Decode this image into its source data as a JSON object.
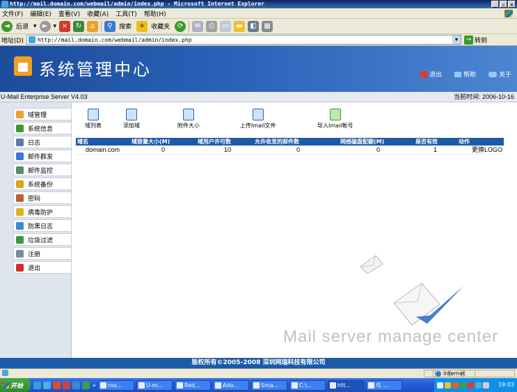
{
  "window": {
    "title": "http://mail.domain.com/webmail/admin/index.php - Microsoft Internet Explorer",
    "controls": [
      "_",
      "▫",
      "×"
    ]
  },
  "menu": [
    "文件(F)",
    "编辑(E)",
    "查看(V)",
    "收藏(A)",
    "工具(T)",
    "帮助(H)"
  ],
  "toolbar": {
    "back": "后退",
    "search": "搜索",
    "favorites": "收藏夹"
  },
  "address": {
    "label": "地址(D)",
    "url": "http://mail.domain.com/webmail/admin/index.php",
    "go": "转到"
  },
  "header": {
    "title": "系统管理中心",
    "logout": "退出",
    "help": "帮助",
    "about": "关于"
  },
  "info": {
    "version": "U-Mail Enterprise Server V4.03",
    "time": "当前时间: 2006-10-16"
  },
  "sidebar": {
    "items": [
      {
        "label": "域管理",
        "color": "#e8a030"
      },
      {
        "label": "系统信息",
        "color": "#3a9a2a"
      },
      {
        "label": "日志",
        "color": "#5a7aa8"
      },
      {
        "label": "邮件群发",
        "color": "#3a7ad0"
      },
      {
        "label": "邮件监控",
        "color": "#5a8a6a"
      },
      {
        "label": "系统备份",
        "color": "#e0a020"
      },
      {
        "label": "密码",
        "color": "#c06030"
      },
      {
        "label": "病毒防护",
        "color": "#e0b020"
      },
      {
        "label": "防黑日志",
        "color": "#3a8ad0"
      },
      {
        "label": "垃圾过滤",
        "color": "#3a9a3a"
      },
      {
        "label": "注册",
        "color": "#7a8aa0"
      },
      {
        "label": "退出",
        "color": "#d03020"
      }
    ]
  },
  "tools": {
    "domain_list": "域列表",
    "add_domain": "添加域",
    "attach_size": "附件大小",
    "upload_imail": "上传Imail文件",
    "import_imail": "导入Imail帐号"
  },
  "table": {
    "headers": [
      "域名",
      "域容量大小(M)",
      "域用户许可数",
      "允许收发的邮件数",
      "网络磁盘配额(M)",
      "是否有效",
      "动作"
    ],
    "rows": [
      [
        "domain.com",
        "0",
        "10",
        "0",
        "0",
        "1",
        "更换LOGO"
      ]
    ]
  },
  "watermark": "Mail server manage center",
  "footer": "版权所有©2005-2008 深圳网瑞科技有限公司",
  "status": {
    "zone": "Internet"
  },
  "taskbar": {
    "start": "开始",
    "chevron": "»",
    "buttons": [
      "roo...",
      "U-m...",
      "Red...",
      "Ado...",
      "Sma...",
      "C:\\...",
      "htt...",
      "与 ..."
    ],
    "clock": "19:03"
  },
  "colors": {
    "header_blue": "#2a62b8",
    "table_header": "#1c5aa8",
    "footer": "#1c5aa8"
  }
}
